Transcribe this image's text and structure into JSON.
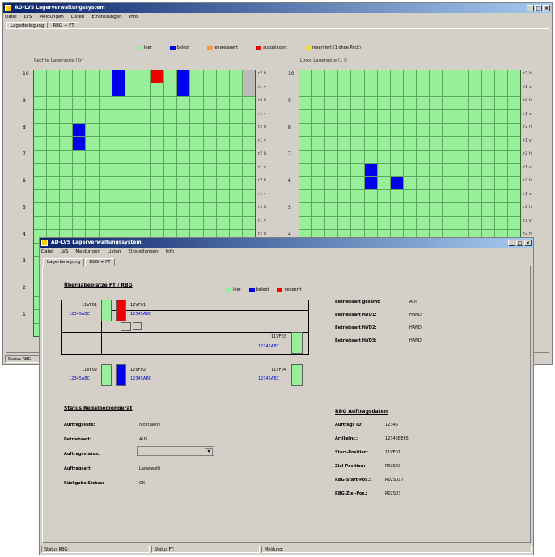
{
  "back_window": {
    "title": "AD-LVS Lagerverwaltungssystem",
    "menu": [
      "Datei",
      "LVS",
      "Meldungen",
      "Listen",
      "Einstellungen",
      "Info"
    ],
    "tabs": [
      "Lagerbelegung",
      "RBG + FT"
    ],
    "legend": [
      {
        "label": "leer",
        "color": "#99ee99"
      },
      {
        "label": "belegt",
        "color": "#0000ee"
      },
      {
        "label": "eingelagert",
        "color": "#f0a040"
      },
      {
        "label": "ausgelagert",
        "color": "#ee0000"
      },
      {
        "label": "reserviert (1 ohne Pack)",
        "color": "#f0e040"
      }
    ],
    "right_side_title": "Rechte Lagerseite (2r)",
    "left_side_title": "Linke Lagerseite (1 l)",
    "row_labels_right": [
      "10",
      "9",
      "8",
      "7",
      "6",
      "5",
      "4",
      "3",
      "2",
      "1"
    ],
    "row_labels_left": [
      "10",
      "9",
      "8",
      "7",
      "6",
      "5",
      "4"
    ],
    "side_labels_mid": [
      "r2 h",
      "r1 v",
      "r2 h",
      "r1 v",
      "r2 h",
      "r1 v",
      "r2 h",
      "r1 v",
      "r2 h",
      "r1 v",
      "r2 h",
      "r1 v",
      "r2 h",
      "r1 v",
      "r2 h",
      "r1 v",
      "r2 h",
      "r1 v",
      "r2 h",
      "r1 v"
    ],
    "side_labels_right": [
      "r2 h",
      "r1 v",
      "r2 h",
      "r1 v",
      "r2 h",
      "r1 v",
      "r2 h",
      "r1 v",
      "r2 h",
      "r1 v",
      "r2 h",
      "r1 v",
      "r2 h",
      "r1 v",
      "r2 h",
      "r1 v",
      "r2 h",
      "r1 v",
      "r2 h",
      "r1 v"
    ],
    "status": "Status RBG"
  },
  "front_window": {
    "title": "AD-LVS Lagerverwaltungssystem",
    "menu": [
      "Datei",
      "LVS",
      "Meldungen",
      "Listen",
      "Einstellungen",
      "Info"
    ],
    "tabs": [
      "Lagerbelegung",
      "RBG + FT"
    ],
    "section_title": "Übergabeplätze FT / RBG",
    "legend": [
      {
        "label": "leer",
        "color": "#99ee99"
      },
      {
        "label": "belegt",
        "color": "#0000ee"
      },
      {
        "label": "gesperrt",
        "color": "#ee0000"
      }
    ],
    "slots": {
      "top_left_name": "11VF01",
      "top_left_code": "12345ABC",
      "top_right_name": "12VF01",
      "top_right_code": "12345ABC",
      "mid_right_name": "11VF03",
      "mid_right_code": "12345ABC",
      "bottom_left_name": "11VF02",
      "bottom_left_code": "12345ABC",
      "bottom_mid_name": "12VF02",
      "bottom_mid_code": "12345ABC",
      "bottom_right_name": "11VF04",
      "bottom_right_code": "12345ABC"
    },
    "mode": [
      {
        "label": "Betriebsart gesamt:",
        "value": "AUS"
      },
      {
        "label": "Betriebsart HVD1:",
        "value": "HAND"
      },
      {
        "label": "Betriebsart HVD2:",
        "value": "HAND"
      },
      {
        "label": "Betriebsart HVD3:",
        "value": "HAND"
      }
    ],
    "status_title": "Status Regalbediengerät",
    "status_fields": [
      {
        "label": "Auftragsliste:",
        "value": "nicht aktiv"
      },
      {
        "label": "Betriebsart:",
        "value": "AUS"
      },
      {
        "label": "Auftragsstatus:",
        "value": ""
      },
      {
        "label": "Auftragsart:",
        "value": "Lagerwahl"
      },
      {
        "label": "Rückgabe Status:",
        "value": "OK"
      }
    ],
    "rbg_title": "RBG Auftragsdaten",
    "rbg_fields": [
      {
        "label": "Auftrags ID:",
        "value": "12345"
      },
      {
        "label": "Artikelnr.:",
        "value": "12345BE65"
      },
      {
        "label": "Start-Position:",
        "value": "11VF01"
      },
      {
        "label": "Ziel-Position:",
        "value": "R02S03"
      },
      {
        "label": "RBG-Start-Pos.:",
        "value": "R02S017"
      },
      {
        "label": "RBG-Ziel-Pos.:",
        "value": "R02S03"
      }
    ],
    "status_bar": [
      "Status RBG:",
      "Status FT:",
      "Meldung:"
    ]
  }
}
